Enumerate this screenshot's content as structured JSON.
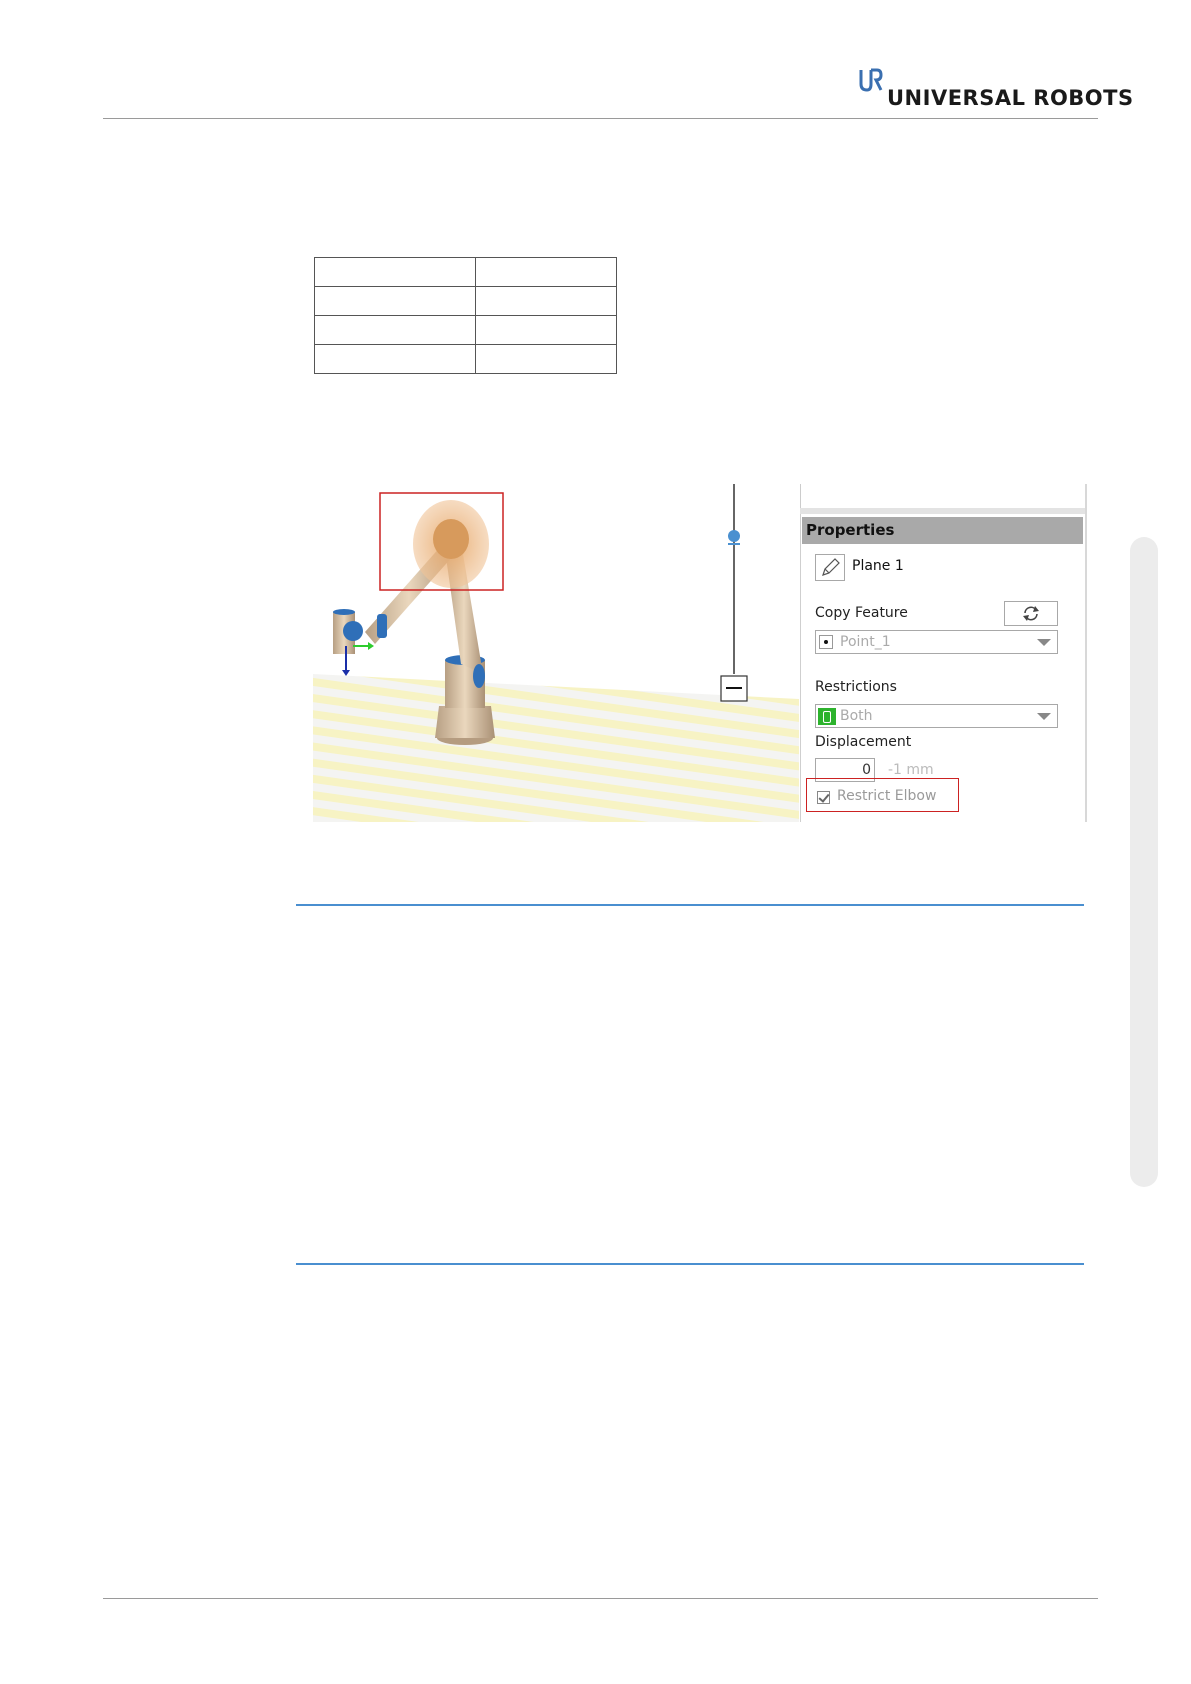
{
  "header": {
    "logo_text": "UNIVERSAL ROBOTS",
    "logo_mark": "UR"
  },
  "table": {
    "rows": [
      [
        "",
        ""
      ],
      [
        "",
        ""
      ],
      [
        "",
        ""
      ],
      [
        "",
        ""
      ]
    ]
  },
  "figure": {
    "panel": {
      "header": "Properties",
      "edit_icon": "pencil-icon",
      "plane_name": "Plane 1",
      "copy_feature_label": "Copy Feature",
      "refresh_icon": "refresh-icon",
      "point_value": "Point_1",
      "restrictions_label": "Restrictions",
      "restrictions_value": "Both",
      "displacement_label": "Displacement",
      "displacement_value": "0",
      "displacement_unit": "-1 mm",
      "restrict_elbow_label": "Restrict Elbow",
      "restrict_elbow_checked": true
    },
    "colors": {
      "highlight": "#cc2222",
      "panel_header": "#a9a9a9",
      "restriction_icon": "#2db32d",
      "joint_blue": "#2f6fb8"
    }
  },
  "colors": {
    "section_rule": "#4a8fd0"
  }
}
